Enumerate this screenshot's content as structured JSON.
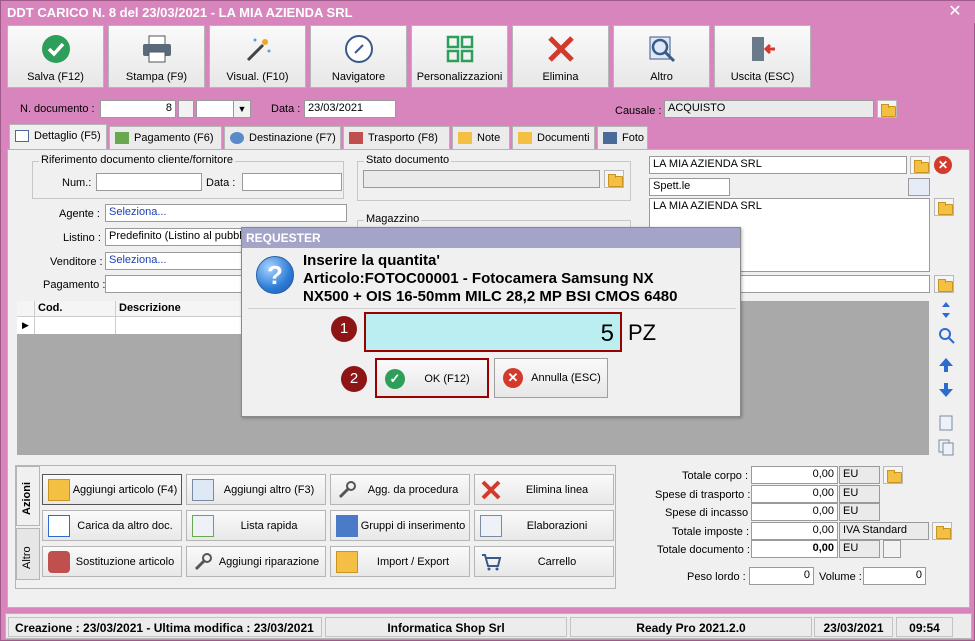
{
  "window": {
    "title": "DDT CARICO N. 8 del 23/03/2021 - LA MIA AZIENDA SRL"
  },
  "toolbar": [
    {
      "label": "Salva (F12)",
      "icon": "check-circle-icon"
    },
    {
      "label": "Stampa (F9)",
      "icon": "printer-icon"
    },
    {
      "label": "Visual. (F10)",
      "icon": "magic-wand-icon"
    },
    {
      "label": "Navigatore",
      "icon": "compass-icon"
    },
    {
      "label": "Personalizzazioni",
      "icon": "grid-icon"
    },
    {
      "label": "Elimina",
      "icon": "delete-x-icon"
    },
    {
      "label": "Altro",
      "icon": "magnifier-icon"
    },
    {
      "label": "Uscita (ESC)",
      "icon": "exit-door-icon"
    }
  ],
  "header": {
    "ndoc_label": "N. documento :",
    "ndoc_value": "8",
    "data_label": "Data :",
    "data_value": "23/03/2021",
    "causale_label": "Causale :",
    "causale_value": "ACQUISTO"
  },
  "tabs": [
    "Dettaglio (F5)",
    "Pagamento (F6)",
    "Destinazione (F7)",
    "Trasporto (F8)",
    "Note",
    "Documenti",
    "Foto"
  ],
  "form": {
    "rif_title": "Riferimento documento cliente/fornitore",
    "num_label": "Num.:",
    "data_label": "Data :",
    "agente_label": "Agente :",
    "agente_value": "Seleziona...",
    "listino_label": "Listino :",
    "listino_value": "Predefinito (Listino al pubblico)",
    "venditore_label": "Venditore :",
    "venditore_value": "Seleziona...",
    "pagamento_label": "Pagamento :",
    "stato_title": "Stato documento",
    "magazzino_title": "Magazzino",
    "cliente_name": "LA MIA AZIENDA SRL",
    "spett": "Spett.le",
    "address": "LA MIA AZIENDA SRL"
  },
  "grid": {
    "columns": [
      "Cod.",
      "Descrizione"
    ]
  },
  "actions": {
    "vtabs": [
      "Azioni",
      "Altro"
    ],
    "buttons": [
      {
        "label": "Aggiungi articolo (F4)",
        "icon": "add-article-icon"
      },
      {
        "label": "Aggiungi altro (F3)",
        "icon": "add-other-icon"
      },
      {
        "label": "Agg. da procedura",
        "icon": "wrench-icon"
      },
      {
        "label": "Elimina linea",
        "icon": "delete-x-icon"
      },
      {
        "label": "Carica da altro doc.",
        "icon": "checklist-icon"
      },
      {
        "label": "Lista rapida",
        "icon": "quick-list-icon"
      },
      {
        "label": "Gruppi di inserimento",
        "icon": "groups-icon"
      },
      {
        "label": "Elaborazioni",
        "icon": "gear-doc-icon"
      },
      {
        "label": "Sostituzione articolo",
        "icon": "replace-icon"
      },
      {
        "label": "Aggiungi riparazione",
        "icon": "wrench-icon"
      },
      {
        "label": "Import / Export",
        "icon": "import-export-icon"
      },
      {
        "label": "Carrello",
        "icon": "cart-icon"
      }
    ]
  },
  "totals": [
    {
      "label": "Totale corpo :",
      "value": "0,00",
      "suffix": "EU"
    },
    {
      "label": "Spese di trasporto :",
      "value": "0,00",
      "suffix": "EU"
    },
    {
      "label": "Spese di incasso :",
      "value": "0,00",
      "suffix": "EU"
    },
    {
      "label": "Totale imposte :",
      "value": "0,00",
      "suffix": "IVA Standard"
    },
    {
      "label": "Totale documento :",
      "value": "0,00",
      "suffix": "EU"
    }
  ],
  "weights": {
    "peso_label": "Peso lordo :",
    "peso_value": "0",
    "volume_label": "Volume :",
    "volume_value": "0"
  },
  "status": {
    "creation": "Creazione : 23/03/2021 - Ultima modifica : 23/03/2021",
    "company": "Informatica Shop Srl",
    "version": "Ready Pro 2021.2.0",
    "date": "23/03/2021",
    "time": "09:54"
  },
  "dialog": {
    "title": "REQUESTER",
    "line1": "Inserire la quantita'",
    "line2": "Articolo:FOTOC00001 - Fotocamera Samsung NX",
    "line3": "NX500 + OIS 16-50mm MILC 28,2 MP BSI CMOS 6480",
    "quantity": "5",
    "unit": "PZ",
    "ok_label": "OK (F12)",
    "cancel_label": "Annulla (ESC)",
    "marker1": "1",
    "marker2": "2"
  }
}
